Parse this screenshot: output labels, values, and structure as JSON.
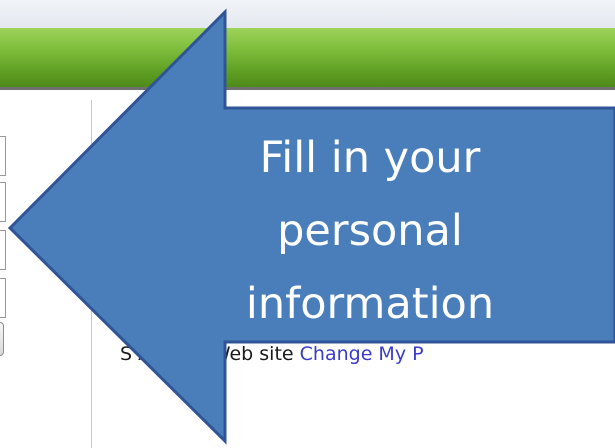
{
  "page": {
    "link_line": {
      "visible_start": "S",
      "visible_text": "Aid PIN Web site",
      "link_label": "Change My P"
    }
  },
  "callout": {
    "lines": [
      "Fill in your",
      "personal",
      "information"
    ],
    "color": "#4a7ebb",
    "border_color": "#2f5597",
    "text_color": "#ffffff",
    "arrow_direction": "left"
  },
  "colors": {
    "header_green": "#7fbe3c",
    "link_blue": "#3b3bc9"
  }
}
